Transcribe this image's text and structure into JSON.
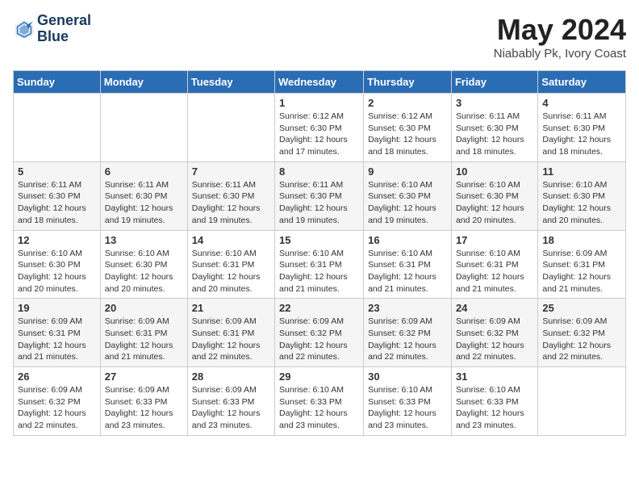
{
  "header": {
    "logo_line1": "General",
    "logo_line2": "Blue",
    "month": "May 2024",
    "location": "Niabably Pk, Ivory Coast"
  },
  "weekdays": [
    "Sunday",
    "Monday",
    "Tuesday",
    "Wednesday",
    "Thursday",
    "Friday",
    "Saturday"
  ],
  "weeks": [
    [
      {
        "day": "",
        "info": ""
      },
      {
        "day": "",
        "info": ""
      },
      {
        "day": "",
        "info": ""
      },
      {
        "day": "1",
        "info": "Sunrise: 6:12 AM\nSunset: 6:30 PM\nDaylight: 12 hours\nand 17 minutes."
      },
      {
        "day": "2",
        "info": "Sunrise: 6:12 AM\nSunset: 6:30 PM\nDaylight: 12 hours\nand 18 minutes."
      },
      {
        "day": "3",
        "info": "Sunrise: 6:11 AM\nSunset: 6:30 PM\nDaylight: 12 hours\nand 18 minutes."
      },
      {
        "day": "4",
        "info": "Sunrise: 6:11 AM\nSunset: 6:30 PM\nDaylight: 12 hours\nand 18 minutes."
      }
    ],
    [
      {
        "day": "5",
        "info": "Sunrise: 6:11 AM\nSunset: 6:30 PM\nDaylight: 12 hours\nand 18 minutes."
      },
      {
        "day": "6",
        "info": "Sunrise: 6:11 AM\nSunset: 6:30 PM\nDaylight: 12 hours\nand 19 minutes."
      },
      {
        "day": "7",
        "info": "Sunrise: 6:11 AM\nSunset: 6:30 PM\nDaylight: 12 hours\nand 19 minutes."
      },
      {
        "day": "8",
        "info": "Sunrise: 6:11 AM\nSunset: 6:30 PM\nDaylight: 12 hours\nand 19 minutes."
      },
      {
        "day": "9",
        "info": "Sunrise: 6:10 AM\nSunset: 6:30 PM\nDaylight: 12 hours\nand 19 minutes."
      },
      {
        "day": "10",
        "info": "Sunrise: 6:10 AM\nSunset: 6:30 PM\nDaylight: 12 hours\nand 20 minutes."
      },
      {
        "day": "11",
        "info": "Sunrise: 6:10 AM\nSunset: 6:30 PM\nDaylight: 12 hours\nand 20 minutes."
      }
    ],
    [
      {
        "day": "12",
        "info": "Sunrise: 6:10 AM\nSunset: 6:30 PM\nDaylight: 12 hours\nand 20 minutes."
      },
      {
        "day": "13",
        "info": "Sunrise: 6:10 AM\nSunset: 6:30 PM\nDaylight: 12 hours\nand 20 minutes."
      },
      {
        "day": "14",
        "info": "Sunrise: 6:10 AM\nSunset: 6:31 PM\nDaylight: 12 hours\nand 20 minutes."
      },
      {
        "day": "15",
        "info": "Sunrise: 6:10 AM\nSunset: 6:31 PM\nDaylight: 12 hours\nand 21 minutes."
      },
      {
        "day": "16",
        "info": "Sunrise: 6:10 AM\nSunset: 6:31 PM\nDaylight: 12 hours\nand 21 minutes."
      },
      {
        "day": "17",
        "info": "Sunrise: 6:10 AM\nSunset: 6:31 PM\nDaylight: 12 hours\nand 21 minutes."
      },
      {
        "day": "18",
        "info": "Sunrise: 6:09 AM\nSunset: 6:31 PM\nDaylight: 12 hours\nand 21 minutes."
      }
    ],
    [
      {
        "day": "19",
        "info": "Sunrise: 6:09 AM\nSunset: 6:31 PM\nDaylight: 12 hours\nand 21 minutes."
      },
      {
        "day": "20",
        "info": "Sunrise: 6:09 AM\nSunset: 6:31 PM\nDaylight: 12 hours\nand 21 minutes."
      },
      {
        "day": "21",
        "info": "Sunrise: 6:09 AM\nSunset: 6:31 PM\nDaylight: 12 hours\nand 22 minutes."
      },
      {
        "day": "22",
        "info": "Sunrise: 6:09 AM\nSunset: 6:32 PM\nDaylight: 12 hours\nand 22 minutes."
      },
      {
        "day": "23",
        "info": "Sunrise: 6:09 AM\nSunset: 6:32 PM\nDaylight: 12 hours\nand 22 minutes."
      },
      {
        "day": "24",
        "info": "Sunrise: 6:09 AM\nSunset: 6:32 PM\nDaylight: 12 hours\nand 22 minutes."
      },
      {
        "day": "25",
        "info": "Sunrise: 6:09 AM\nSunset: 6:32 PM\nDaylight: 12 hours\nand 22 minutes."
      }
    ],
    [
      {
        "day": "26",
        "info": "Sunrise: 6:09 AM\nSunset: 6:32 PM\nDaylight: 12 hours\nand 22 minutes."
      },
      {
        "day": "27",
        "info": "Sunrise: 6:09 AM\nSunset: 6:33 PM\nDaylight: 12 hours\nand 23 minutes."
      },
      {
        "day": "28",
        "info": "Sunrise: 6:09 AM\nSunset: 6:33 PM\nDaylight: 12 hours\nand 23 minutes."
      },
      {
        "day": "29",
        "info": "Sunrise: 6:10 AM\nSunset: 6:33 PM\nDaylight: 12 hours\nand 23 minutes."
      },
      {
        "day": "30",
        "info": "Sunrise: 6:10 AM\nSunset: 6:33 PM\nDaylight: 12 hours\nand 23 minutes."
      },
      {
        "day": "31",
        "info": "Sunrise: 6:10 AM\nSunset: 6:33 PM\nDaylight: 12 hours\nand 23 minutes."
      },
      {
        "day": "",
        "info": ""
      }
    ]
  ]
}
